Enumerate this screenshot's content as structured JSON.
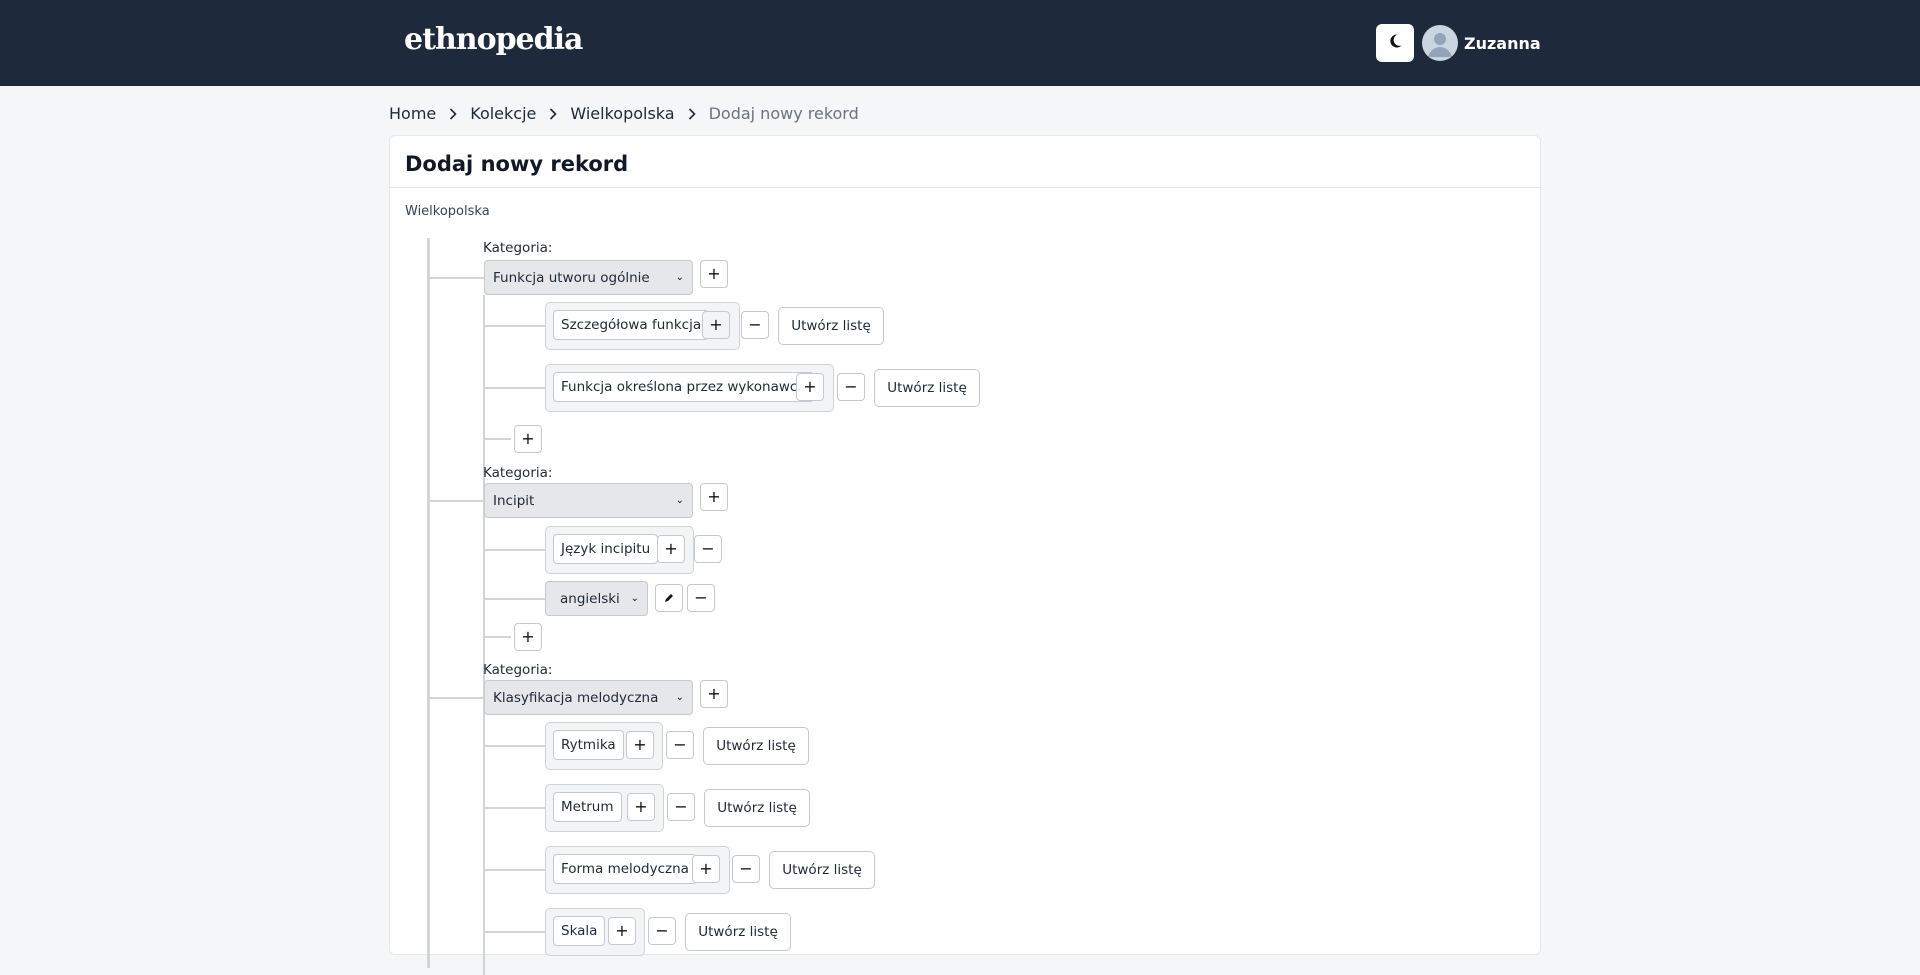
{
  "header": {
    "logo": "ethnopedia",
    "user_name": "Zuzanna",
    "theme_icon": "moon-icon",
    "avatar_icon": "user-avatar-icon"
  },
  "breadcrumb": [
    "Home",
    "Kolekcje",
    "Wielkopolska",
    "Dodaj nowy rekord"
  ],
  "page": {
    "title": "Dodaj nowy rekord",
    "collection": "Wielkopolska"
  },
  "form": {
    "category_label": "Kategoria:",
    "create_list_label": "Utwórz listę",
    "categories": [
      {
        "selected": "Funkcja utworu ogólnie",
        "fields": [
          "Szczegółowa funkcja",
          "Funkcja określona przez wykonawcę"
        ]
      },
      {
        "selected": "Incipit",
        "fields": [
          "Język incipitu"
        ],
        "value_select": "angielski"
      },
      {
        "selected": "Klasyfikacja melodyczna",
        "fields": [
          "Rytmika",
          "Metrum",
          "Forma melodyczna",
          "Skala"
        ]
      }
    ]
  },
  "colors": {
    "navbar": "#1e293b",
    "background": "#f5f6f8",
    "tree_line": "#d1d5db"
  }
}
